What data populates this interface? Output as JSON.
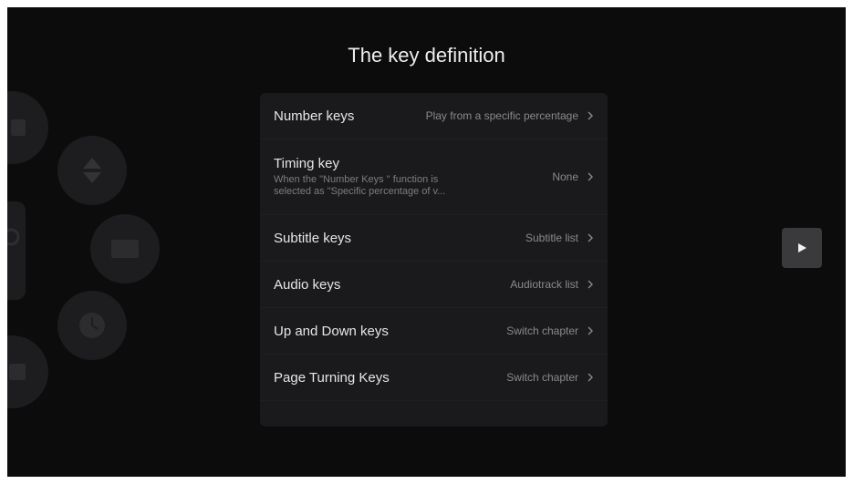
{
  "page": {
    "title": "The key definition"
  },
  "settings": [
    {
      "label": "Number keys",
      "desc": "",
      "value": "Play from a specific percentage"
    },
    {
      "label": "Timing key",
      "desc": "When the \"Number Keys \" function is\nselected as \"Specific percentage of v...",
      "value": "None"
    },
    {
      "label": "Subtitle keys",
      "desc": "",
      "value": "Subtitle list"
    },
    {
      "label": "Audio keys",
      "desc": "",
      "value": "Audiotrack list"
    },
    {
      "label": "Up and Down keys",
      "desc": "",
      "value": "Switch chapter"
    },
    {
      "label": "Page Turning Keys",
      "desc": "",
      "value": "Switch chapter"
    }
  ],
  "icons": {
    "row_chevron": "chevron-right-icon",
    "play": "play-icon",
    "remote_keys": [
      "number-key-icon",
      "up-down-arrow-icon",
      "subtitle-key-icon",
      "clock-icon",
      "calendar-icon",
      "audio-key-icon"
    ]
  },
  "colors": {
    "background": "#0c0c0d",
    "panel": "#1a1a1c",
    "text_primary": "#e6e6e6",
    "text_secondary": "#8a8a8d",
    "play_button": "#3a3a3c"
  }
}
